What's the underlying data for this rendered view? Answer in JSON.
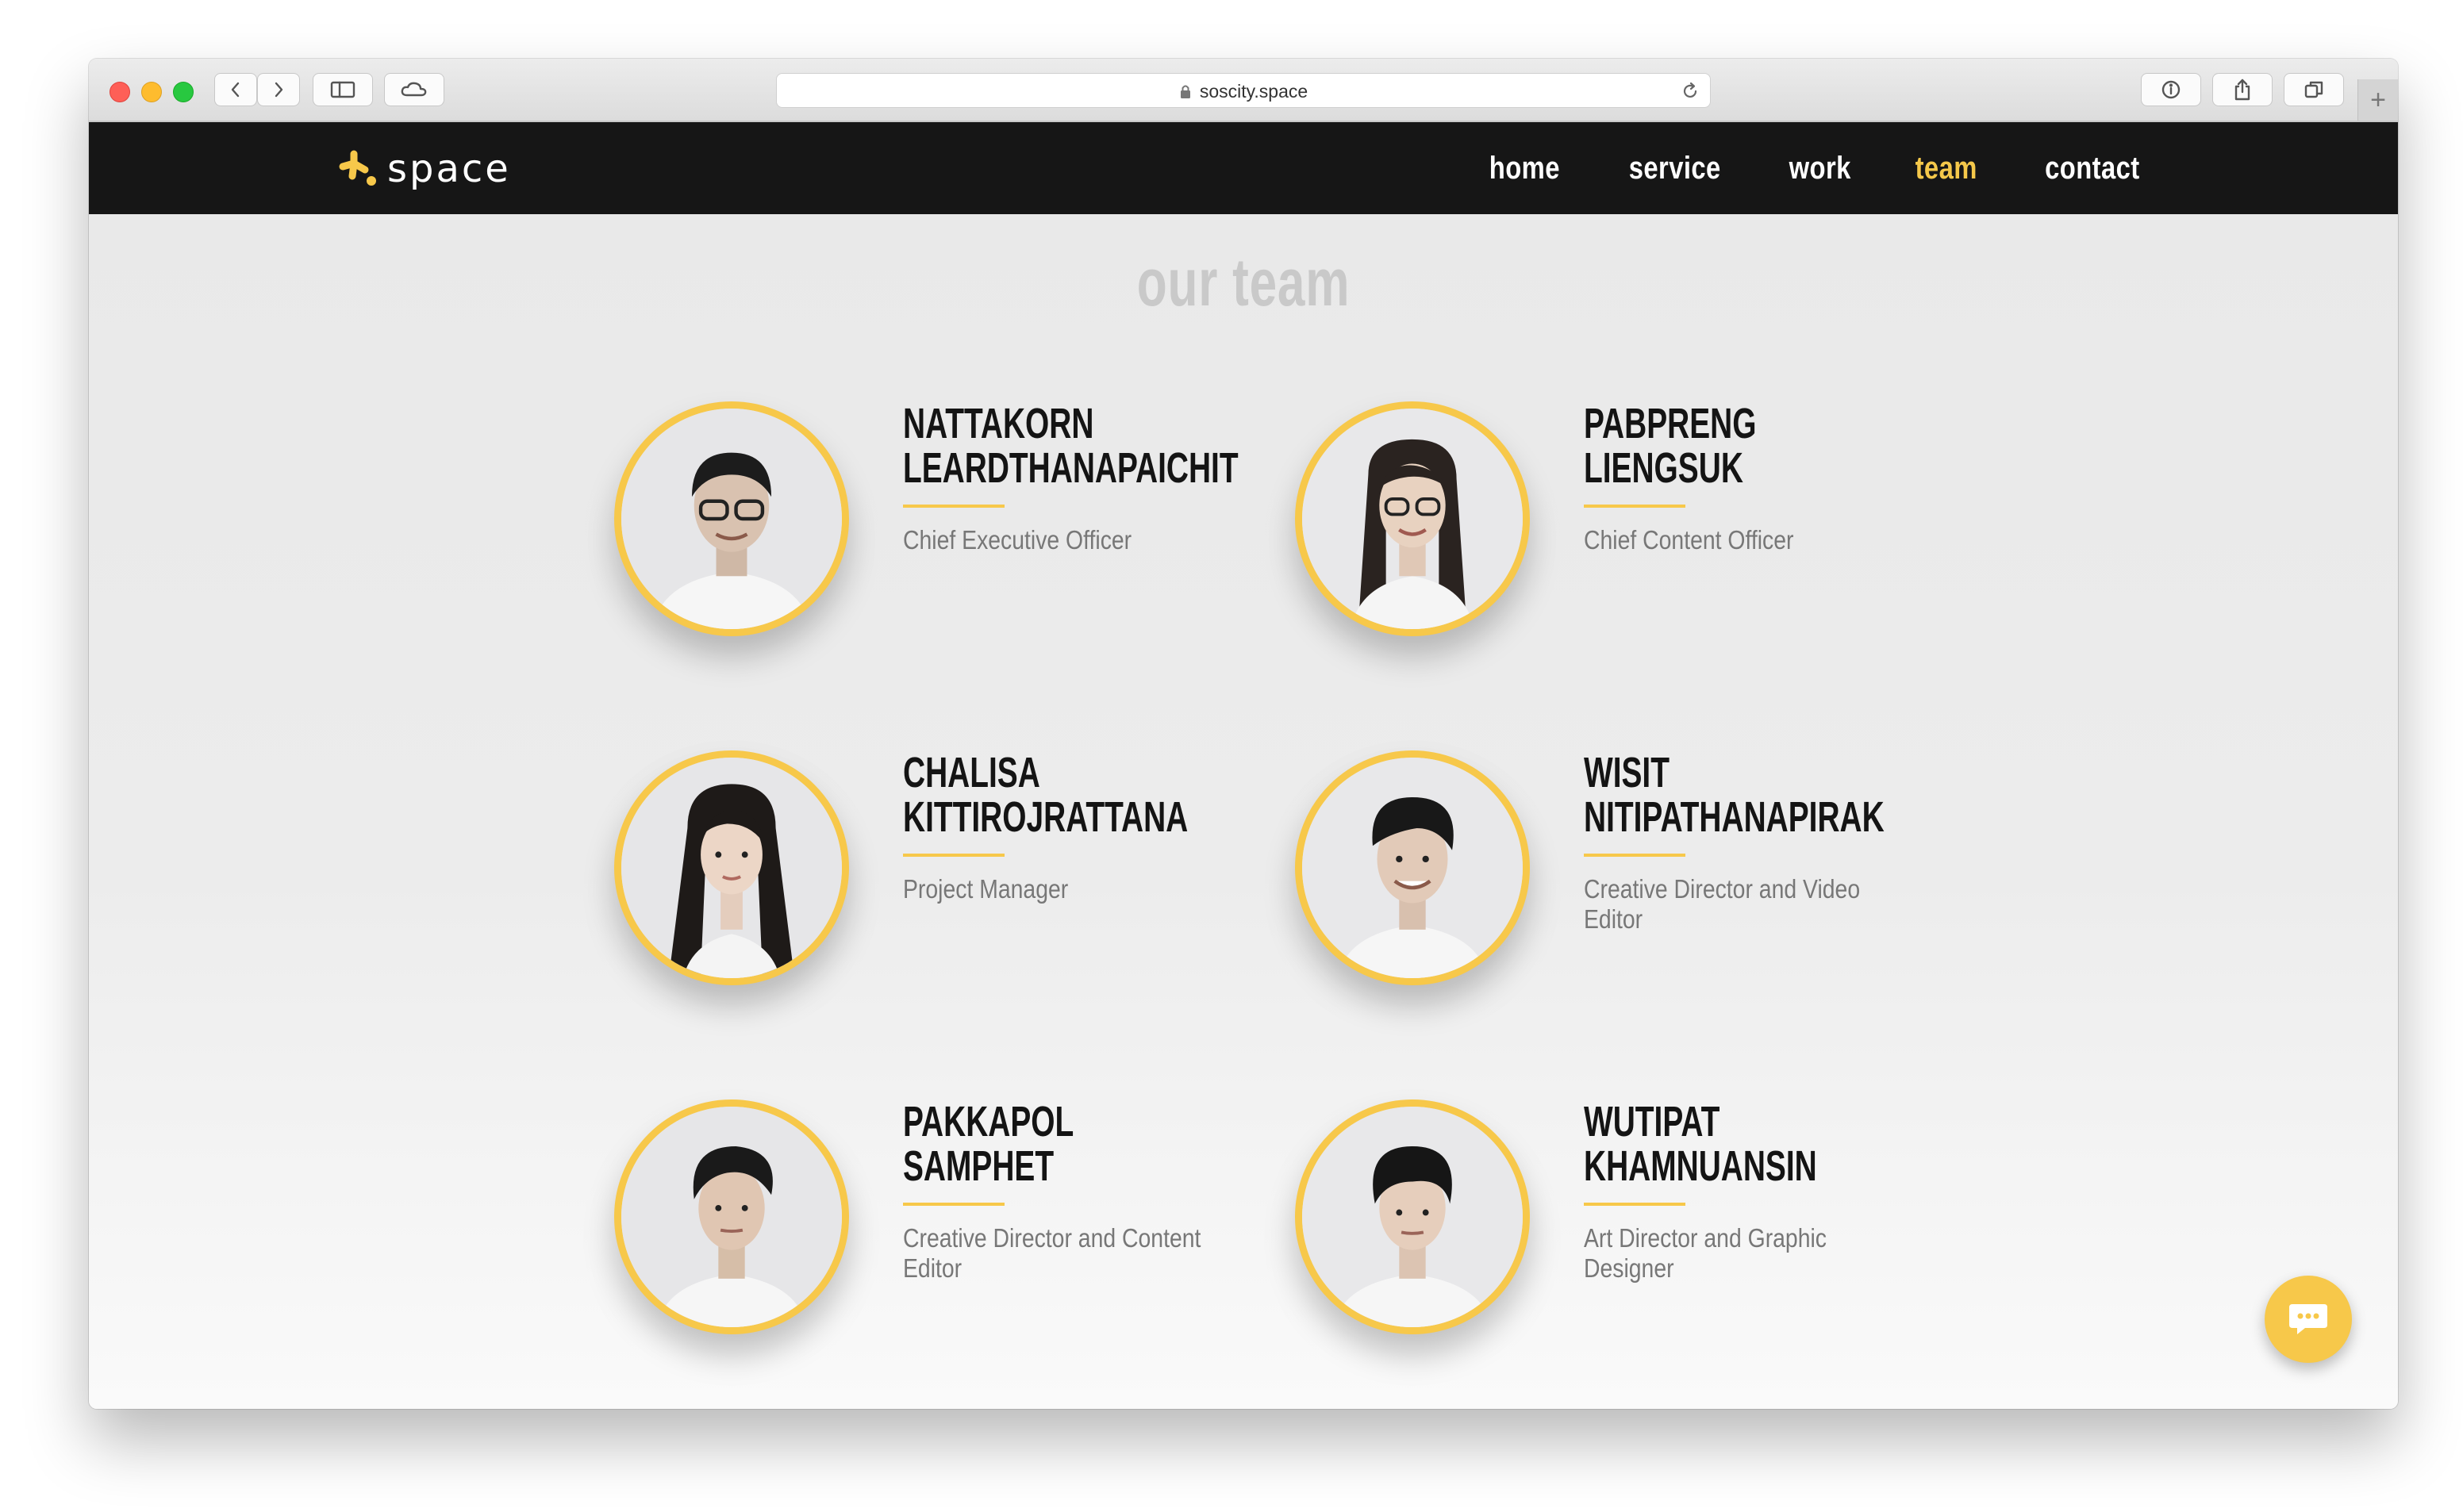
{
  "browser": {
    "url": "soscity.space",
    "new_tab_label": "+"
  },
  "site": {
    "logo_text": "space",
    "nav": [
      {
        "label": "home",
        "active": false
      },
      {
        "label": "service",
        "active": false
      },
      {
        "label": "work",
        "active": false
      },
      {
        "label": "team",
        "active": true
      },
      {
        "label": "contact",
        "active": false
      }
    ]
  },
  "team": {
    "title": "our team",
    "members": [
      {
        "first": "NATTAKORN",
        "last": "LEARDTHANAPAICHIT",
        "role": "Chief Executive Officer"
      },
      {
        "first": "PABPRENG",
        "last": "LIENGSUK",
        "role": "Chief Content Officer"
      },
      {
        "first": "CHALISA",
        "last": "KITTIROJRATTANA",
        "role": "Project Manager"
      },
      {
        "first": "WISIT",
        "last": "NITIPATHANAPIRAK",
        "role": "Creative Director and Video Editor"
      },
      {
        "first": "PAKKAPOL",
        "last": "SAMPHET",
        "role": "Creative Director and Content Editor"
      },
      {
        "first": "WUTIPAT",
        "last": "KHAMNUANSIN",
        "role": "Art Director and Graphic Designer"
      }
    ]
  },
  "colors": {
    "accent": "#f7c84a",
    "nav_bg": "#161616",
    "title_grey": "#c9c9c9"
  },
  "icons": {
    "chat": "chat-bubble-icon",
    "lock": "lock-icon",
    "reload": "reload-icon"
  }
}
